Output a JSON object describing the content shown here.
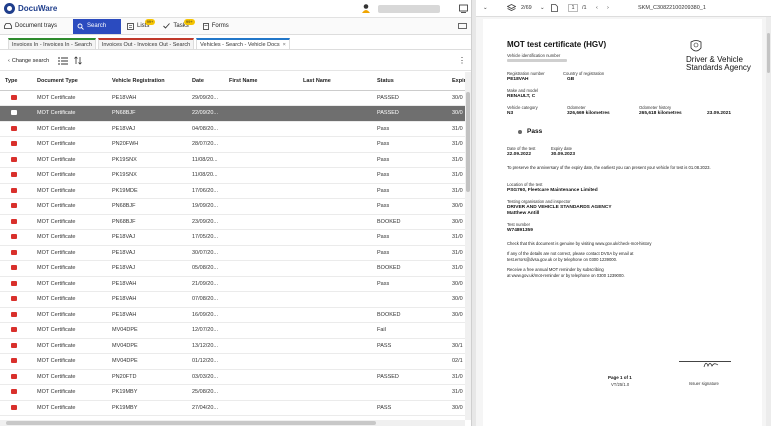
{
  "app": {
    "brand": "DocuWare"
  },
  "toolbar": {
    "document_trays": "Document trays",
    "search": "Search",
    "lists": "Lists",
    "lists_badge": "99+",
    "tasks": "Tasks",
    "tasks_badge": "99+",
    "forms": "Forms"
  },
  "tabs": [
    {
      "label": "Invoices In - Invoices In - Search"
    },
    {
      "label": "Invoices Out - Invoices Out - Search"
    },
    {
      "label": "Vehicles - Search - Vehicle Docs"
    }
  ],
  "subbar": {
    "change_search": "Change search"
  },
  "table": {
    "columns": [
      "Type",
      "Document Type",
      "Vehicle Registration",
      "Date",
      "First Name",
      "Last Name",
      "Status",
      "Expiry d"
    ],
    "rows": [
      [
        "MOT Certificate",
        "PE18VAH",
        "29/09/20...",
        "",
        "",
        "PASSED",
        "30/0"
      ],
      [
        "MOT Certificate",
        "PN68BJF",
        "22/09/20...",
        "",
        "",
        "PASSED",
        "30/0"
      ],
      [
        "MOT Certificate",
        "PE18VAJ",
        "04/08/20...",
        "",
        "",
        "Pass",
        "31/0"
      ],
      [
        "MOT Certificate",
        "PN20FWH",
        "28/07/20...",
        "",
        "",
        "Pass",
        "31/0"
      ],
      [
        "MOT Certificate",
        "PK19SNX",
        "11/08/20...",
        "",
        "",
        "Pass",
        "31/0"
      ],
      [
        "MOT Certificate",
        "PK19SNX",
        "11/08/20...",
        "",
        "",
        "Pass",
        "31/0"
      ],
      [
        "MOT Certificate",
        "PK19MDE",
        "17/06/20...",
        "",
        "",
        "Pass",
        "31/0"
      ],
      [
        "MOT Certificate",
        "PN68BJF",
        "19/09/20...",
        "",
        "",
        "Pass",
        "30/0"
      ],
      [
        "MOT Certificate",
        "PN68BJF",
        "23/09/20...",
        "",
        "",
        "BOOKED",
        "30/0"
      ],
      [
        "MOT Certificate",
        "PE18VAJ",
        "17/05/20...",
        "",
        "",
        "Pass",
        "31/0"
      ],
      [
        "MOT Certificate",
        "PE18VAJ",
        "30/07/20...",
        "",
        "",
        "Pass",
        "31/0"
      ],
      [
        "MOT Certificate",
        "PE18VAJ",
        "05/08/20...",
        "",
        "",
        "BOOKED",
        "31/0"
      ],
      [
        "MOT Certificate",
        "PE18VAH",
        "21/09/20...",
        "",
        "",
        "Pass",
        "30/0"
      ],
      [
        "MOT Certificate",
        "PE18VAH",
        "07/08/20...",
        "",
        "",
        "",
        "30/0"
      ],
      [
        "MOT Certificate",
        "PE18VAH",
        "16/09/20...",
        "",
        "",
        "BOOKED",
        "30/0"
      ],
      [
        "MOT Certificate",
        "MV04DPE",
        "12/07/20...",
        "",
        "",
        "Fail",
        ""
      ],
      [
        "MOT Certificate",
        "MV04DPE",
        "13/12/20...",
        "",
        "",
        "PASS",
        "30/1"
      ],
      [
        "MOT Certificate",
        "MV04DPE",
        "01/12/20...",
        "",
        "",
        "",
        "02/1"
      ],
      [
        "MOT Certificate",
        "PN20FTD",
        "03/03/20...",
        "",
        "",
        "PASSED",
        "31/0"
      ],
      [
        "MOT Certificate",
        "PK19MBY",
        "25/08/20...",
        "",
        "",
        "",
        "31/0"
      ],
      [
        "MOT Certificate",
        "PK19MBY",
        "27/04/20...",
        "",
        "",
        "PASS",
        "30/0"
      ]
    ]
  },
  "viewer": {
    "page_info": "2/69",
    "page_current": "1",
    "page_total": "/1",
    "filename": "SKM_C30822100209380_1"
  },
  "document": {
    "title": "MOT test certificate (HGV)",
    "agency": "Driver & Vehicle Standards Agency",
    "vin_label": "Vehicle identification number",
    "reg_label": "Registration number",
    "reg_value": "PE18VAH",
    "country_label": "Country of registration",
    "country_value": "GB",
    "make_label": "Make and model",
    "make_value": "RENAULT, C",
    "category_label": "Vehicle category",
    "category_value": "N3",
    "odometer_label": "Odometer",
    "odometer_value": "326,669 kilometres",
    "history_label": "Odometer history",
    "history_value": "265,618 kilometres",
    "history_date": "23.09.2021",
    "result": "Pass",
    "test_date_label": "Date of the test",
    "test_date_value": "22.09.2022",
    "expiry_label": "Expiry date",
    "expiry_value": "30.09.2023",
    "preserve_text": "To preserve the anniversary of the expiry date, the earliest you can present your vehicle for test is 01.08.2023.",
    "location_label": "Location of the test",
    "location_value": "PSG760, Fleetcare Maintenance Limited",
    "org_label": "Testing organisation and inspector",
    "org_value": "DRIVER AND VEHICLE STANDARDS AGENCY",
    "inspector": "Matthew Antill",
    "test_number_label": "Test number",
    "test_number_value": "W74891359",
    "check_text": "Check that this document is genuine by visiting www.gov.uk/check-mot-history",
    "incorrect_text": "If any of the details are not correct, please contact DVSA by email at",
    "contact_text": "test.errors@dvsa.gov.uk or by telephone on 0300 1239000.",
    "reminder_text": "Receive a free annual MOT reminder by subscribing",
    "reminder_text2": "at www.gov.uk/mot-reminder or by telephone on 0300 1239000.",
    "page_of": "Page 1 of 1",
    "version": "VT/25/1.0",
    "issuer": "Issuer signature"
  }
}
